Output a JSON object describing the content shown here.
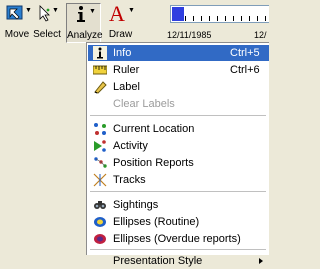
{
  "toolbar": {
    "move_label": "Move",
    "select_label": "Select",
    "analyze_label": "Analyze",
    "draw_label": "Draw"
  },
  "timeline": {
    "date_left": "12/11/1985",
    "date_right": "12/"
  },
  "menu": {
    "items": [
      {
        "label": "Info",
        "shortcut": "Ctrl+5",
        "icon": "info-icon"
      },
      {
        "label": "Ruler",
        "shortcut": "Ctrl+6",
        "icon": "ruler-icon"
      },
      {
        "label": "Label",
        "icon": "label-icon"
      },
      {
        "label": "Clear Labels",
        "icon": ""
      },
      {
        "label": "Current Location",
        "icon": "current-location-icon"
      },
      {
        "label": "Activity",
        "icon": "activity-icon"
      },
      {
        "label": "Position Reports",
        "icon": "position-reports-icon"
      },
      {
        "label": "Tracks",
        "icon": "tracks-icon"
      },
      {
        "label": "Sightings",
        "icon": "sightings-icon"
      },
      {
        "label": "Ellipses (Routine)",
        "icon": "ellipse-routine-icon"
      },
      {
        "label": "Ellipses (Overdue reports)",
        "icon": "ellipse-overdue-icon"
      },
      {
        "label": "Presentation Style",
        "icon": ""
      }
    ]
  },
  "colors": {
    "highlight": "#316ac5",
    "menu_bg": "#ffffff",
    "toolbar_bg": "#ece9d8"
  }
}
